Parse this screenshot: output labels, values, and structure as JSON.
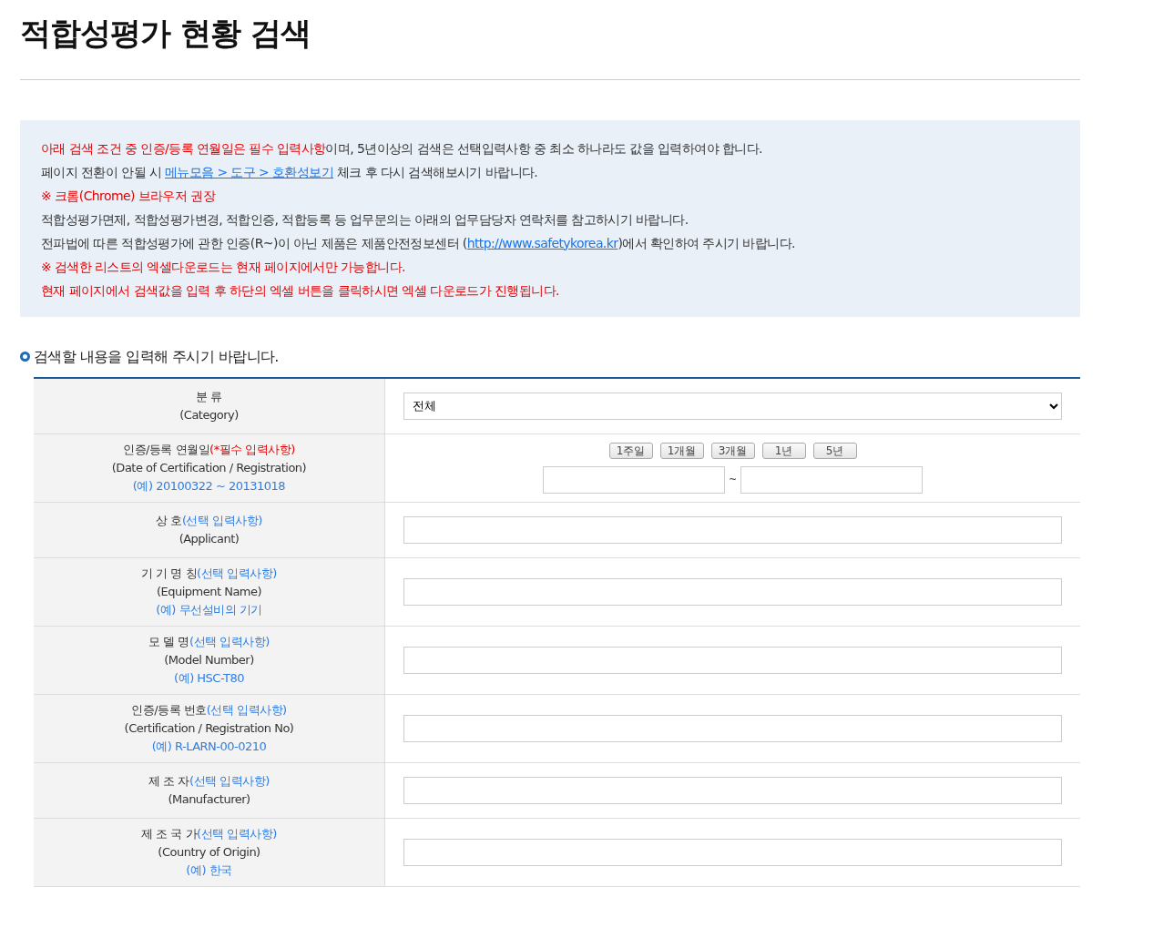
{
  "title": "적합성평가 현황 검색",
  "notice": [
    [
      {
        "kind": "red",
        "text": "아래 검색 조건 중 인증/등록 연월일은 필수 입력사항"
      },
      {
        "kind": "plain",
        "text": "이며, 5년이상의 검색은 선택입력사항 중 최소 하나라도 값을 입력하여야 합니다."
      }
    ],
    [
      {
        "kind": "plain",
        "text": "페이지 전환이 안될 시 "
      },
      {
        "kind": "link",
        "text": "메뉴모음 > 도구 > 호환성보기"
      },
      {
        "kind": "plain",
        "text": " 체크 후 다시 검색해보시기 바랍니다."
      }
    ],
    [
      {
        "kind": "red",
        "text": "※ 크롬(Chrome) 브라우저 권장"
      }
    ],
    [
      {
        "kind": "plain",
        "text": "적합성평가면제, 적합성평가변경, 적합인증, 적합등록 등 업무문의는 아래의 업무담당자 연락처를 참고하시기 바랍니다."
      }
    ],
    [
      {
        "kind": "plain",
        "text": "전파법에 따른 적합성평가에 관한 인증(R~)이 아닌 제품은 제품안전정보센터 ("
      },
      {
        "kind": "link",
        "text": "http://www.safetykorea.kr"
      },
      {
        "kind": "plain",
        "text": ")에서 확인하여 주시기 바랍니다."
      }
    ],
    [
      {
        "kind": "red",
        "text": "※ 검색한 리스트의 엑셀다운로드는 현재 페이지에서만 가능합니다."
      }
    ],
    [
      {
        "kind": "red",
        "text": "현재 페이지에서 검색값을 입력 후 하단의 엑셀 버튼을 클릭하시면 엑셀 다운로드가 진행됩니다."
      }
    ]
  ],
  "section_heading": "검색할 내용을 입력해 주시기 바랍니다.",
  "rows": [
    {
      "label": "분 류",
      "english": "(Category)",
      "kind": "select",
      "value": "전체"
    },
    {
      "label": "인증/등록 연월일",
      "note": "(*필수 입력사항)",
      "required": true,
      "english": "(Date of Certification / Registration)",
      "example": "(예) 20100322 ~ 20131018",
      "kind": "daterange",
      "presets": [
        "1주일",
        "1개월",
        "3개월",
        "1년",
        "5년"
      ],
      "separator": "~"
    },
    {
      "label": "상 호",
      "note": "(선택 입력사항)",
      "required": false,
      "english": "(Applicant)",
      "kind": "text"
    },
    {
      "label": "기 기 명 칭",
      "note": "(선택 입력사항)",
      "required": false,
      "english": "(Equipment Name)",
      "example": "(예) 무선설비의 기기",
      "kind": "text"
    },
    {
      "label": "모 델 명",
      "note": "(선택 입력사항)",
      "required": false,
      "english": "(Model Number)",
      "example": "(예) HSC-T80",
      "kind": "text"
    },
    {
      "label": "인증/등록 번호",
      "note": "(선택 입력사항)",
      "required": false,
      "english": "(Certification / Registration No)",
      "example": "(예) R-LARN-00-0210",
      "kind": "text"
    },
    {
      "label": "제 조 자",
      "note": "(선택 입력사항)",
      "required": false,
      "english": "(Manufacturer)",
      "kind": "text"
    },
    {
      "label": "제 조 국 가",
      "note": "(선택 입력사항)",
      "required": false,
      "english": "(Country of Origin)",
      "example": "(예) 한국",
      "kind": "text"
    }
  ]
}
